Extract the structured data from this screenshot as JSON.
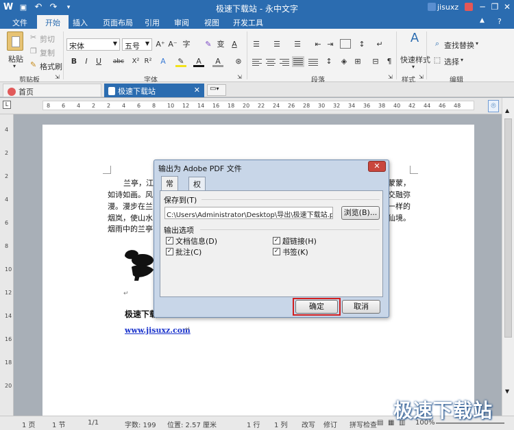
{
  "titlebar": {
    "app_icon": "W",
    "title": "极速下载站 - 永中文字",
    "user": "jisuxz",
    "undo_glyph": "↶",
    "redo_glyph": "↷",
    "save_glyph": "💾",
    "min_glyph": "─",
    "restore_glyph": "❐",
    "close_glyph": "✕"
  },
  "menu": [
    "文件",
    "开始",
    "插入",
    "页面布局",
    "引用",
    "审阅",
    "视图",
    "开发工具"
  ],
  "menu_active": "开始",
  "ribbon": {
    "clipboard": {
      "paste": "粘贴",
      "cut": "剪切",
      "copy": "复制",
      "format_painter": "格式刷",
      "group": "剪贴板"
    },
    "font": {
      "font_name": "宋体",
      "font_size": "五号",
      "group": "字体",
      "bold": "B",
      "italic": "I",
      "underline": "U",
      "strike": "abc",
      "superscript": "X²",
      "subscript": "X₂",
      "grow": "A⁺",
      "shrink": "A⁻",
      "rotate": "R²"
    },
    "paragraph": {
      "group": "段落"
    },
    "styles": {
      "quick_styles": "快速样式",
      "group": "样式"
    },
    "editing": {
      "find_replace": "查找替换",
      "select": "选择",
      "group": "编辑"
    }
  },
  "doc_tabs": {
    "home": "首页",
    "doc": "极速下载站"
  },
  "ruler_h": [
    "8",
    "6",
    "4",
    "2",
    "2",
    "4",
    "6",
    "8",
    "10",
    "12",
    "14",
    "16",
    "18",
    "20",
    "22",
    "24",
    "26",
    "28",
    "30",
    "32",
    "34",
    "36",
    "38",
    "40",
    "42",
    "44",
    "46",
    "48"
  ],
  "ruler_v": [
    "4",
    "2",
    "2",
    "4",
    "6",
    "8",
    "10",
    "12",
    "14",
    "16",
    "18",
    "20"
  ],
  "document": {
    "line1_start": "兰亭，江",
    "line1_end": "蒙蒙，",
    "line2_start": "如诗如画。风",
    "line2_end": "交融弥",
    "line3_start": "漫。漫步在兰",
    "line3_end": "一样的",
    "line4_start": "烟岚，使山水",
    "line4_end": "仙境。",
    "line5_start": "烟雨中的兰亭",
    "heading": "极速下载",
    "link": "www.jisuxz.com"
  },
  "dialog": {
    "title": "输出为 Adobe PDF 文件",
    "tab_general": "常规",
    "tab_permission": "权限设置",
    "save_to_label": "保存到(T)",
    "path": "C:\\Users\\Administrator\\Desktop\\导出\\极速下载站.pdf",
    "browse": "浏览(B)...",
    "options_label": "输出选项",
    "opt_docinfo": "文档信息(D)",
    "opt_comments": "批注(C)",
    "opt_hyperlink": "超链接(H)",
    "opt_bookmark": "书签(K)",
    "ok": "确定",
    "cancel": "取消",
    "highlight_color": "#d21e1e"
  },
  "status": {
    "page": "1 页",
    "section": "1 节",
    "pages": "1/1",
    "words": "字数: 199",
    "position": "位置: 2.57 厘米",
    "line": "1 行",
    "col": "1 列",
    "overwrite": "改写",
    "revise": "修订",
    "spellcheck": "拼写检查",
    "zoom": "100%"
  },
  "watermark": "极速下载站",
  "colors": {
    "accent": "#2b6cb0",
    "dialog_frame": "#c8d6e8",
    "close_red": "#c9463d"
  }
}
